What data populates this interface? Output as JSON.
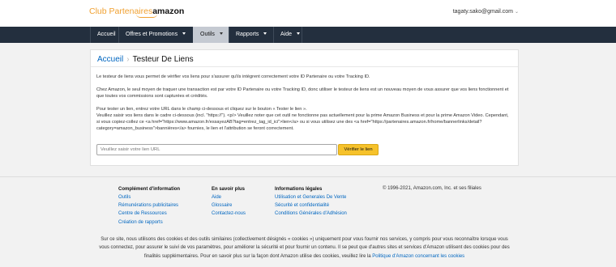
{
  "header": {
    "logo_prefix": "Club Partenaires",
    "logo_brand": "amazon",
    "account_email": "tagaty.sako@gmail.com"
  },
  "nav": {
    "items": [
      {
        "label": "Accueil"
      },
      {
        "label": "Offres et Promotions"
      },
      {
        "label": "Outils"
      },
      {
        "label": "Rapports"
      },
      {
        "label": "Aide"
      }
    ]
  },
  "main": {
    "breadcrumb_home": "Accueil",
    "breadcrumb_sep": "›",
    "page_title": "Testeur De Liens",
    "paragraph1": "Le testeur de liens vous permet de vérifier vos liens pour s'assurer qu'ils intègrent correctement votre ID Partenaire ou votre Tracking ID.",
    "paragraph2": "Chez Amazon, le seul moyen de traquer une transaction est par votre ID Partenaire ou votre Tracking ID, donc utiliser le testeur de liens est un nouveau moyen de vous assurer que vos liens fonctionnent et que toutes vos commissions sont capturées et crédités.",
    "paragraph3_line1": "Pour tester un lien, entrez votre URL dans le champ ci-dessous et cliquez sur le bouton « Tester le lien ».",
    "paragraph3_rest": "Veuillez saisir vos liens dans le cadre ci-dessous (incl. \"https://\"). <p/> Veuillez noter que cet outil ne fonctionne pas actuellement pour la prime Amazon Business et pour la prime Amazon Video. Cependant, si vous copiez-collez ce <a href=\"https://www.amazon.fr/essayezAB?tag=entrez_tag_id_ici\">lien</a> ou si vous utilisez une des <a href=\"https://partenaires.amazon.fr/home/bannerlinks/detail?category=amazon_business\">bannières</a> fournies, le lien et l'attribution se feront correctement.",
    "url_placeholder": "Veuillez saisir votre lien URL",
    "check_button": "Vérifier le lien"
  },
  "footer": {
    "col1": {
      "heading": "Complément d'information",
      "links": [
        "Outils",
        "Rémunérations publicitaires",
        "Centre de Ressources",
        "Création de rapports"
      ]
    },
    "col2": {
      "heading": "En savoir plus",
      "links": [
        "Aide",
        "Glossaire",
        "Contactez-nous"
      ]
    },
    "col3": {
      "heading": "Informations légales",
      "links": [
        "Utilisation et Generales De Vente",
        "Sécurité et confidentialité",
        "Conditions Générales d'Adhésion"
      ]
    },
    "copyright": "© 1996-2021, Amazon.com, Inc. et ses filiales"
  },
  "cookie_notice": {
    "text": "Sur ce site, nous utilisons des cookies et des outils similaires (collectivement désignés « cookies ») uniquement pour vous fournir nos services, y compris pour vous reconnaître lorsque vous vous connectez, pour assurer le suivi de vos paramètres, pour améliorer la sécurité et pour fournir un contenu. Il se peut que d'autres sites et services d'Amazon utilisent des cookies pour des finalités supplémentaires. Pour en savoir plus sur la façon dont Amazon utilise des cookies, veuillez lire la ",
    "link": "Politique d'Amazon concernant les cookies"
  },
  "colors": {
    "nav_bg": "#232f3e",
    "accent_orange": "#f0a030",
    "button_yellow": "#f6c22b",
    "link_blue": "#0066c0"
  }
}
